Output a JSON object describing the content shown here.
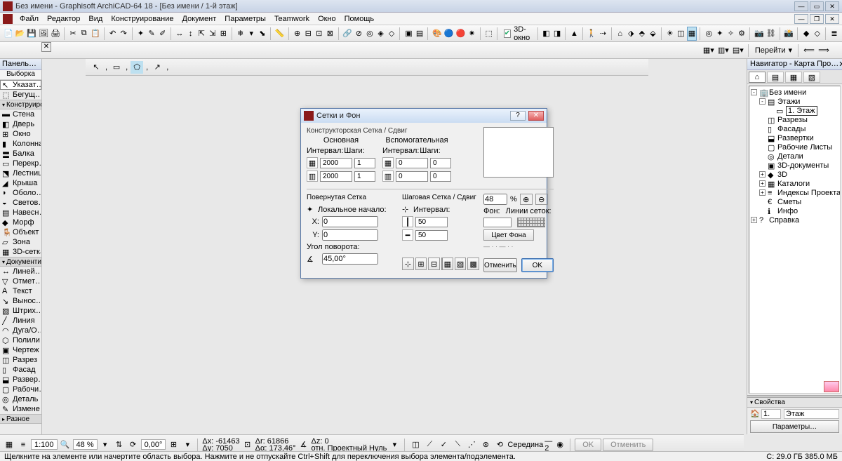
{
  "title": "Без имени - Graphisoft ArchiCAD-64 18 - [Без имени / 1-й этаж]",
  "menu": [
    "Файл",
    "Редактор",
    "Вид",
    "Конструирование",
    "Документ",
    "Параметры",
    "Teamwork",
    "Окно",
    "Помощь"
  ],
  "toolbar2": {
    "goto": "Перейти",
    "view3d": "3D-окно"
  },
  "leftPanel": {
    "head": "Панель…",
    "sub": "Выборка",
    "groups": [
      {
        "type": "item",
        "label": "Указат…",
        "sel": true,
        "icon": "arrow"
      },
      {
        "type": "item",
        "label": "Бегущ…",
        "icon": "marquee"
      },
      {
        "type": "sep",
        "label": "Конструирс",
        "open": true
      },
      {
        "type": "item",
        "label": "Стена",
        "icon": "wall"
      },
      {
        "type": "item",
        "label": "Дверь",
        "icon": "door"
      },
      {
        "type": "item",
        "label": "Окно",
        "icon": "window"
      },
      {
        "type": "item",
        "label": "Колонна",
        "icon": "column"
      },
      {
        "type": "item",
        "label": "Балка",
        "icon": "beam"
      },
      {
        "type": "item",
        "label": "Перекр…",
        "icon": "slab"
      },
      {
        "type": "item",
        "label": "Лестница",
        "icon": "stair"
      },
      {
        "type": "item",
        "label": "Крыша",
        "icon": "roof"
      },
      {
        "type": "item",
        "label": "Оболо…",
        "icon": "shell"
      },
      {
        "type": "item",
        "label": "Светов…",
        "icon": "skylight"
      },
      {
        "type": "item",
        "label": "Навесн…",
        "icon": "curtain"
      },
      {
        "type": "item",
        "label": "Морф",
        "icon": "morph"
      },
      {
        "type": "item",
        "label": "Объект",
        "icon": "object"
      },
      {
        "type": "item",
        "label": "Зона",
        "icon": "zone"
      },
      {
        "type": "item",
        "label": "3D-сетка",
        "icon": "mesh"
      },
      {
        "type": "sep",
        "label": "Документир",
        "open": true
      },
      {
        "type": "item",
        "label": "Линей…",
        "icon": "dim"
      },
      {
        "type": "item",
        "label": "Отмет…",
        "icon": "level"
      },
      {
        "type": "item",
        "label": "Текст",
        "icon": "text"
      },
      {
        "type": "item",
        "label": "Вынос…",
        "icon": "label"
      },
      {
        "type": "item",
        "label": "Штрих…",
        "icon": "fill"
      },
      {
        "type": "item",
        "label": "Линия",
        "icon": "line"
      },
      {
        "type": "item",
        "label": "Дуга/О…",
        "icon": "arc"
      },
      {
        "type": "item",
        "label": "Полили…",
        "icon": "poly"
      },
      {
        "type": "item",
        "label": "Чертеж",
        "icon": "drawing"
      },
      {
        "type": "item",
        "label": "Разрез",
        "icon": "section"
      },
      {
        "type": "item",
        "label": "Фасад",
        "icon": "elev"
      },
      {
        "type": "item",
        "label": "Развер…",
        "icon": "ie"
      },
      {
        "type": "item",
        "label": "Рабочи…",
        "icon": "ws"
      },
      {
        "type": "item",
        "label": "Деталь",
        "icon": "detail"
      },
      {
        "type": "item",
        "label": "Измене…",
        "icon": "change"
      },
      {
        "type": "sep",
        "label": "Разное"
      }
    ]
  },
  "navigator": {
    "head": "Навигатор - Карта Про…",
    "tree": [
      {
        "ind": 0,
        "exp": "-",
        "icon": "proj",
        "label": "Без имени"
      },
      {
        "ind": 1,
        "exp": "-",
        "icon": "stories",
        "label": "Этажи"
      },
      {
        "ind": 2,
        "exp": "",
        "icon": "story",
        "label": "1. Этаж",
        "sel": true
      },
      {
        "ind": 1,
        "exp": "",
        "icon": "sec",
        "label": "Разрезы"
      },
      {
        "ind": 1,
        "exp": "",
        "icon": "elev",
        "label": "Фасады"
      },
      {
        "ind": 1,
        "exp": "",
        "icon": "ie",
        "label": "Развертки"
      },
      {
        "ind": 1,
        "exp": "",
        "icon": "ws",
        "label": "Рабочие Листы"
      },
      {
        "ind": 1,
        "exp": "",
        "icon": "det",
        "label": "Детали"
      },
      {
        "ind": 1,
        "exp": "",
        "icon": "3dd",
        "label": "3D-документы"
      },
      {
        "ind": 1,
        "exp": "+",
        "icon": "3d",
        "label": "3D"
      },
      {
        "ind": 1,
        "exp": "+",
        "icon": "sched",
        "label": "Каталоги"
      },
      {
        "ind": 1,
        "exp": "+",
        "icon": "idx",
        "label": "Индексы Проекта"
      },
      {
        "ind": 1,
        "exp": "",
        "icon": "est",
        "label": "Сметы"
      },
      {
        "ind": 1,
        "exp": "",
        "icon": "info",
        "label": "Инфо"
      },
      {
        "ind": 0,
        "exp": "+",
        "icon": "help",
        "label": "Справка"
      }
    ],
    "propsHead": "Свойства",
    "propsRow": {
      "num": "1.",
      "name": "Этаж"
    },
    "paramBtn": "Параметры…"
  },
  "dialog": {
    "title": "Сетки и Фон",
    "sec1": "Конструкторская Сетка / Сдвиг",
    "mainLbl": "Основная",
    "auxLbl": "Вспомогательная",
    "intervalLbl": "Интервал:",
    "stepLbl": "Шаги:",
    "mainInt1": "2000",
    "mainStep1": "1",
    "mainInt2": "2000",
    "mainStep2": "1",
    "auxInt1": "0",
    "auxStep1": "0",
    "auxInt2": "0",
    "auxStep2": "0",
    "sec2": "Повернутая Сетка",
    "localOrigin": "Локальное начало:",
    "xLbl": "X:",
    "xVal": "0",
    "yLbl": "Y:",
    "yVal": "0",
    "rotLbl": "Угол поворота:",
    "rotVal": "45,00°",
    "sec3": "Шаговая Сетка / Сдвиг",
    "intLbl2": "Интервал:",
    "snap1": "50",
    "snap2": "50",
    "pct": "48",
    "pctUnit": "%",
    "bgLbl": "Фон:",
    "gridLinesLbl": "Линии сеток:",
    "bgBtn": "Цвет Фона",
    "cancel": "Отменить",
    "ok": "OK"
  },
  "bottom": {
    "zoom": "1:100",
    "pct": "48 %",
    "angle": "0,00°",
    "dx": "Δx: -61463",
    "dy": "Δy: 7050",
    "dr": "Δr: 61866",
    "da": "Δα: 173,46°",
    "dz": "Δz: 0",
    "origin": "отн. Проектный Нуль",
    "snap": "Середина",
    "snapN": "2",
    "okBtn": "OK",
    "cancelBtn": "Отменить"
  },
  "status": {
    "hint": "Щелкните на элементе или начертите область выбора. Нажмите и не отпускайте Ctrl+Shift для переключения выбора элемента/подэлемента.",
    "right": "С: 29.0 ГБ   385.0 МБ"
  }
}
